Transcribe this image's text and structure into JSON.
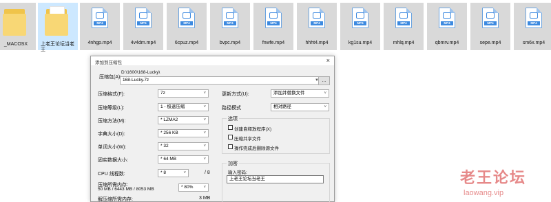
{
  "files": [
    {
      "name": "_MACOSX",
      "type": "folder"
    },
    {
      "name": "上老王论坛当老王",
      "type": "folder"
    },
    {
      "name": "4nhgp.mp4",
      "type": "mp4"
    },
    {
      "name": "4v4dm.mp4",
      "type": "mp4"
    },
    {
      "name": "6cpuz.mp4",
      "type": "mp4"
    },
    {
      "name": "bvpc.mp4",
      "type": "mp4"
    },
    {
      "name": "fnwfe.mp4",
      "type": "mp4"
    },
    {
      "name": "hhht4.mp4",
      "type": "mp4"
    },
    {
      "name": "kg1su.mp4",
      "type": "mp4"
    },
    {
      "name": "mhlq.mp4",
      "type": "mp4"
    },
    {
      "name": "qbmrv.mp4",
      "type": "mp4"
    },
    {
      "name": "sepe.mp4",
      "type": "mp4"
    },
    {
      "name": "sm6x.mp4",
      "type": "mp4"
    }
  ],
  "mp4_tag": "MP4",
  "dialog": {
    "title": "添加到压缩包",
    "close_icon": "×",
    "archive": {
      "label": "压缩包(A):",
      "path": "D:\\1600\\168-Lucky\\",
      "name": "168-Lucky.7z",
      "browse_label": "..."
    },
    "format": {
      "label": "压缩格式(F):",
      "value": "7z"
    },
    "level": {
      "label": "压缩等级(L):",
      "value": "1 - 极速压缩"
    },
    "method": {
      "label": "压缩方法(M):",
      "value": "* LZMA2"
    },
    "dict": {
      "label": "字典大小(D):",
      "value": "* 256 KB"
    },
    "word": {
      "label": "单词大小(W):",
      "value": "* 32"
    },
    "solid": {
      "label": "固实数据大小:",
      "value": "* 64 MB"
    },
    "threads": {
      "label": "CPU 线程数:",
      "value": "* 8",
      "max": "/ 8"
    },
    "mem_compress": {
      "label": "压缩所需内存:",
      "detail": "50 MB / 6443 MB / 8053 MB",
      "value": "* 80%"
    },
    "mem_decompress": {
      "label": "解压缩所需内存:",
      "value": "3 MB"
    },
    "update": {
      "label": "更新方式(U):",
      "value": "添加并替换文件"
    },
    "pathmode": {
      "label": "路径模式",
      "value": "相对路径"
    },
    "options": {
      "title": "选项",
      "items": [
        "创建自释放程序(X)",
        "压缩共享文件",
        "操作完成后删除源文件"
      ]
    },
    "encryption": {
      "title": "加密",
      "pwd_label": "输入密码:",
      "pwd_value": "上老王论坛当老王"
    }
  },
  "watermark": {
    "line1": "老王论坛",
    "line2": "laowang.vip"
  }
}
